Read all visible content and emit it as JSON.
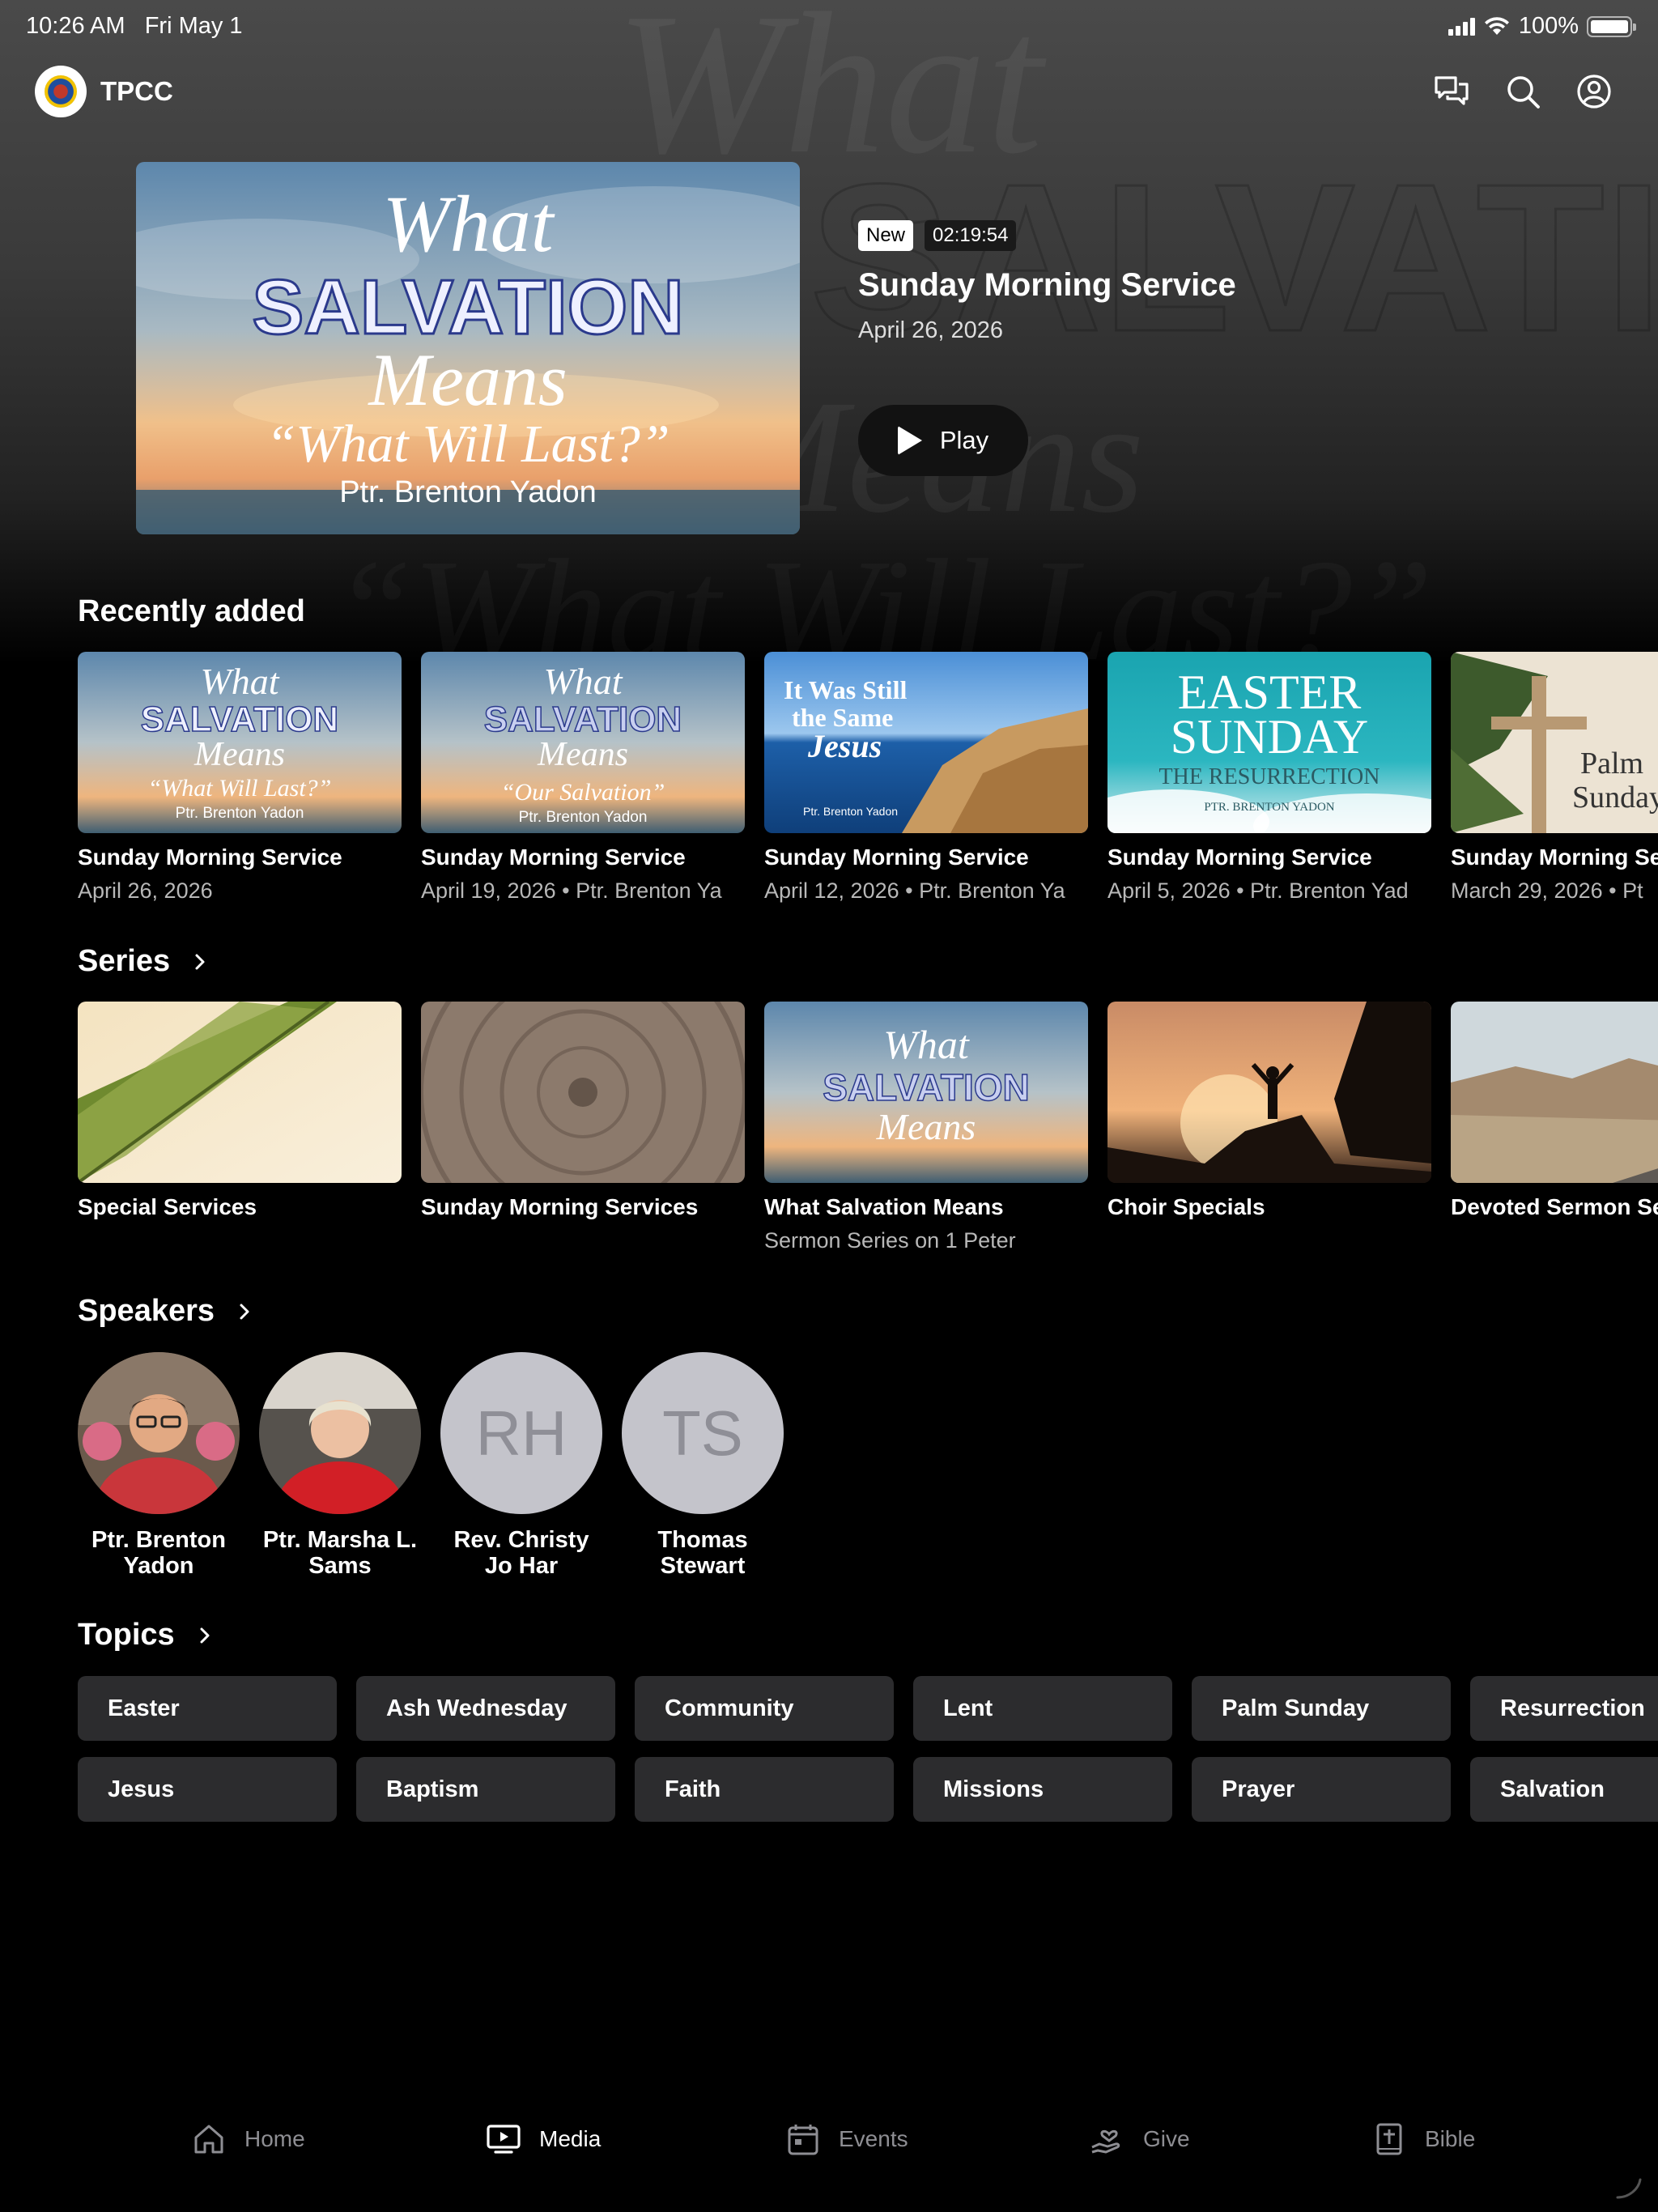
{
  "status_bar": {
    "time": "10:26 AM",
    "date": "Fri May 1",
    "battery": "100%"
  },
  "app": {
    "name": "TPCC"
  },
  "hero": {
    "badge_new": "New",
    "duration": "02:19:54",
    "title": "Sunday Morning Service",
    "date": "April 26, 2026",
    "play_label": "Play",
    "art": {
      "line1": "What",
      "line2": "SALVATION",
      "line3": "Means",
      "line4": "“What Will Last?”",
      "line5": "Ptr. Brenton Yadon"
    }
  },
  "recently_added": {
    "title": "Recently added",
    "items": [
      {
        "title": "Sunday Morning Service",
        "subtitle": "April 26, 2026",
        "art_lines": [
          "What",
          "SALVATION",
          "Means",
          "“What Will Last?”",
          "Ptr. Brenton Yadon"
        ]
      },
      {
        "title": "Sunday Morning Service",
        "subtitle": "April 19, 2026 • Ptr. Brenton Ya",
        "art_lines": [
          "What",
          "SALVATION",
          "Means",
          "“Our Salvation”",
          "Ptr. Brenton Yadon"
        ]
      },
      {
        "title": "Sunday Morning Service",
        "subtitle": "April 12, 2026 • Ptr. Brenton Ya",
        "art_lines": [
          "It Was Still",
          "the Same",
          "Jesus",
          "Ptr. Brenton Yadon"
        ]
      },
      {
        "title": "Sunday Morning Service",
        "subtitle": "April 5, 2026 • Ptr. Brenton Yad",
        "art_lines": [
          "EASTER",
          "SUNDAY",
          "THE RESURRECTION",
          "PTR. BRENTON YADON"
        ]
      },
      {
        "title": "Sunday Morning Se",
        "subtitle": "March 29, 2026 • Pt",
        "art_lines": [
          "Palm",
          "Sunday"
        ]
      }
    ]
  },
  "series": {
    "title": "Series",
    "items": [
      {
        "title": "Special Services",
        "subtitle": ""
      },
      {
        "title": "Sunday Morning Services",
        "subtitle": ""
      },
      {
        "title": "What Salvation Means",
        "subtitle": "Sermon Series on 1 Peter",
        "art_lines": [
          "What",
          "SALVATION",
          "Means"
        ]
      },
      {
        "title": "Choir Specials",
        "subtitle": ""
      },
      {
        "title": "Devoted Sermon Se",
        "subtitle": ""
      }
    ]
  },
  "speakers": {
    "title": "Speakers",
    "items": [
      {
        "name_line1": "Ptr. Brenton",
        "name_line2": "Yadon",
        "initials": ""
      },
      {
        "name_line1": "Ptr. Marsha L.",
        "name_line2": "Sams",
        "initials": ""
      },
      {
        "name_line1": "Rev. Christy",
        "name_line2": "Jo Har",
        "initials": "RH"
      },
      {
        "name_line1": "Thomas",
        "name_line2": "Stewart",
        "initials": "TS"
      }
    ]
  },
  "topics": {
    "title": "Topics",
    "row1": [
      "Easter",
      "Ash Wednesday",
      "Community",
      "Lent",
      "Palm Sunday",
      "Resurrection"
    ],
    "row2": [
      "Jesus",
      "Baptism",
      "Faith",
      "Missions",
      "Prayer",
      "Salvation"
    ]
  },
  "tab_bar": {
    "active": "Media",
    "items": [
      {
        "label": "Home",
        "icon": "house-icon"
      },
      {
        "label": "Media",
        "icon": "tv-play-icon"
      },
      {
        "label": "Events",
        "icon": "calendar-icon"
      },
      {
        "label": "Give",
        "icon": "hand-heart-icon"
      },
      {
        "label": "Bible",
        "icon": "book-cross-icon"
      }
    ]
  },
  "colors": {
    "background": "#000000",
    "chip": "#2c2c2e",
    "muted_text": "#b8b8b8",
    "inactive_tab": "#8e8e93",
    "initials_bg": "#c4c4cb"
  }
}
